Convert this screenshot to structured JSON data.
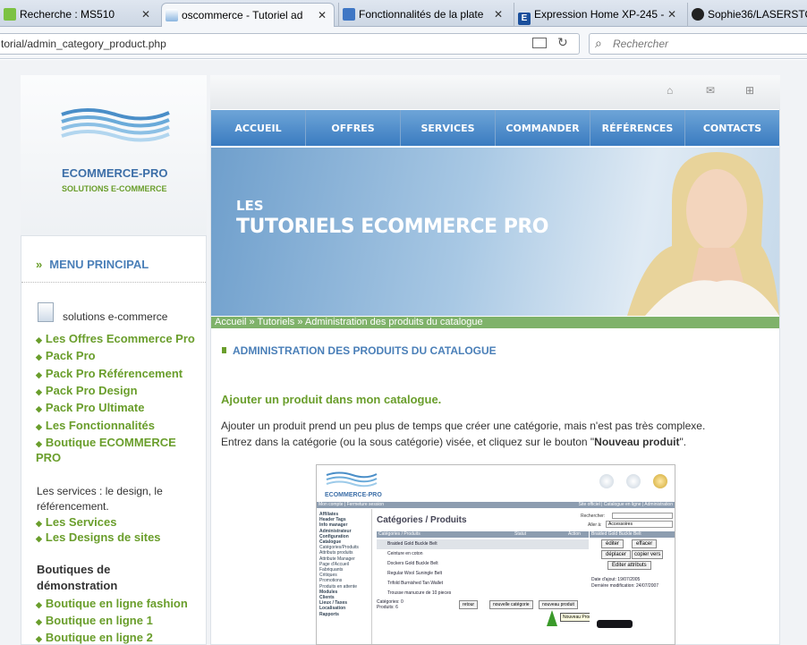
{
  "browser": {
    "tabs": [
      "Recherche : MS510",
      "oscommerce - Tutoriel ad",
      "Fonctionnalités de la plate",
      "Expression Home XP-245 -",
      "Sophie36/LASERSTO"
    ],
    "url": "torial/admin_category_product.php",
    "search_placeholder": "Rechercher"
  },
  "logo": {
    "name": "ECOMMERCE-PRO",
    "tagline": "SOLUTIONS  E-COMMERCE"
  },
  "menu": {
    "heading": "MENU PRINCIPAL",
    "section1": "solutions e-commerce",
    "links1": [
      "Les Offres Ecommerce Pro",
      "Pack Pro",
      "Pack Pro Référencement",
      "Pack Pro Design",
      "Pack Pro Ultimate",
      "Les Fonctionnalités",
      "Boutique ECOMMERCE PRO"
    ],
    "services_text": "Les services : le design, le référencement.",
    "links2": [
      "Les Services",
      "Les Designs de sites"
    ],
    "shops_heading": "Boutiques de démonstration",
    "links3": [
      "Boutique en ligne fashion",
      "Boutique en ligne 1",
      "Boutique en ligne 2"
    ]
  },
  "nav": [
    "ACCUEIL",
    "OFFRES",
    "SERVICES",
    "COMMANDER",
    "RÉFÉRENCES",
    "CONTACTS"
  ],
  "banner": {
    "line1": "LES",
    "line2": "TUTORIELS  ECOMMERCE PRO"
  },
  "breadcrumb": "Accueil » Tutoriels » Administration des produits du catalogue",
  "article": {
    "title": "ADMINISTRATION DES PRODUITS DU CATALOGUE",
    "subtitle": "Ajouter un produit dans mon catalogue.",
    "para_a": "Ajouter un produit prend un peu plus de temps que créer une catégorie, mais n'est pas très complexe.",
    "para_b": "Entrez dans la catégorie (ou la sous catégorie) visée, et cliquez sur le bouton \"",
    "para_bold": "Nouveau produit",
    "para_end": "\"."
  },
  "shot": {
    "logo": "ECOMMERCE-PRO",
    "topbar_left": "Mon compte | Fermeture session",
    "topbar_right": "Site officiel  |  Catalogue en ligne  |  Administration",
    "sidebar": [
      "Affiliates",
      "Header Tags",
      "Info manager",
      "Administrateur",
      "Configuration",
      "Catalogue",
      "Catégories/Produits",
      "Attributs produits",
      "Attribute Manager",
      "Page d'Accueil",
      "Fabriquants",
      "Critiques",
      "Promotions",
      "Produits en attente",
      "Modules",
      "Clients",
      "Lieux / Taxes",
      "Localisation",
      "Rapports"
    ],
    "title": "Catégories / Produits",
    "search_label": "Rechercher:",
    "goto_label": "Aller à:",
    "goto_value": "Accessoires",
    "col_headers": [
      "Catégories / Produits",
      "Statut",
      "Action"
    ],
    "rows": [
      "Braided Gold Buckle Belt",
      "Ceinture en coton",
      "Dockers Gold Buckle Belt",
      "Regular Wool Suningle Belt",
      "Trifold Burnished Tan Wallet",
      "Trousse manucure de 10 pieces"
    ],
    "counts": "Catégories: 0\nProduits: 6",
    "btn_back": "retour",
    "btn_newcat": "nouvelle catégorie",
    "btn_newprod": "nouveau produit",
    "info_title": "Braided Gold Buckle Belt",
    "info_btns": [
      "éditer",
      "effacer",
      "déplacer",
      "copier vers",
      "Editer attributs"
    ],
    "date_added": "Date d'ajout: 19/07/2005",
    "date_mod": "Dernière modification: 24/07/2007",
    "tooltip": "Nouveau Produit"
  }
}
